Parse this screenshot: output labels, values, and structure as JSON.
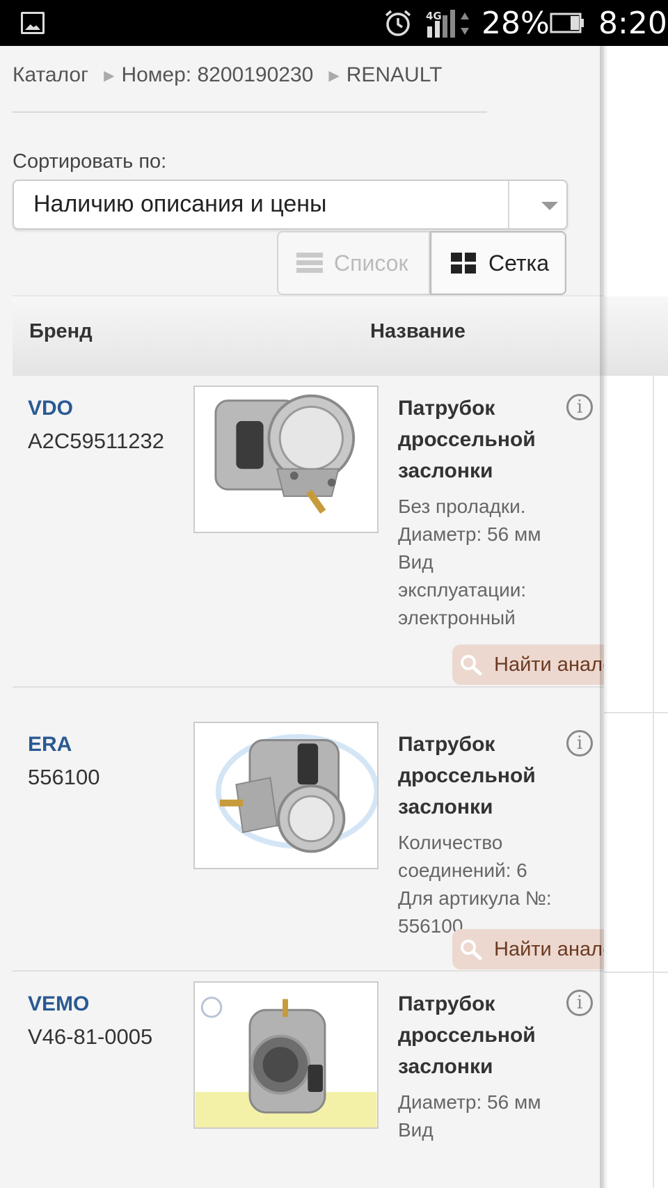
{
  "status_bar": {
    "network": "4G",
    "battery_percent": "28%",
    "time": "8:20"
  },
  "breadcrumb": [
    "Каталог",
    "Номер: 8200190230",
    "RENAULT"
  ],
  "sort": {
    "label": "Сортировать по:",
    "selected": "Наличию описания и цены"
  },
  "view": {
    "list_label": "Список",
    "grid_label": "Сетка",
    "active": "grid"
  },
  "table": {
    "headers": {
      "brand": "Бренд",
      "name": "Название"
    }
  },
  "products": [
    {
      "brand": "VDO",
      "code": "A2C59511232",
      "title": "Патрубок дроссельной заслонки",
      "desc": "Без проладки. Диаметр: 56 мм Вид эксплуатации: электронный",
      "analog_label": "Найти аналоги"
    },
    {
      "brand": "ERA",
      "code": "556100",
      "title": "Патрубок дроссельной заслонки",
      "desc": "Количество соединений: 6 Для артикула №: 556100",
      "analog_label": "Найти аналоги"
    },
    {
      "brand": "VEMO",
      "code": "V46-81-0005",
      "title": "Патрубок дроссельной заслонки",
      "desc": "Диаметр: 56 мм Вид",
      "analog_label": "Найти аналоги"
    }
  ],
  "icons": {
    "info": "info-icon",
    "car": "car-icon",
    "search": "magnifier-icon"
  },
  "colors": {
    "brand_link": "#2a5a93",
    "analog_bg": "#ecd8cf",
    "car_icon": "#2f5fb8"
  }
}
